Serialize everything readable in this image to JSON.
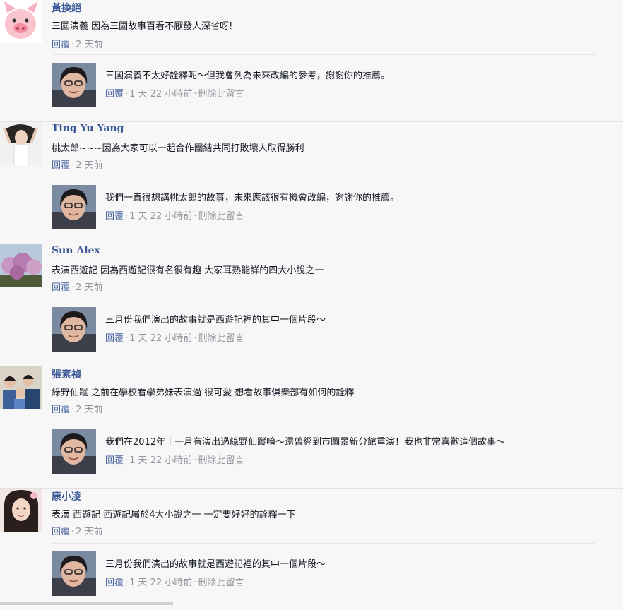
{
  "threads": [
    {
      "author": "黃換絕",
      "text": "三國演義 因為三國故事百看不厭發人深省呀!",
      "reply_label": "回覆",
      "time": "2 天前",
      "reply": {
        "text": "三國演義不太好詮釋呢～但我會列為未來改編的參考，謝謝你的推薦。",
        "reply_label": "回覆",
        "time": "1 天 22 小時前",
        "delete_label": "刪除此留言"
      }
    },
    {
      "author": "Ting Yu Yang",
      "text": "桃太郎~~~因為大家可以一起合作團結共同打敗壞人取得勝利",
      "reply_label": "回覆",
      "time": "2 天前",
      "reply": {
        "text": "我們一直很想講桃太郎的故事，未來應該很有機會改編，謝謝你的推薦。",
        "reply_label": "回覆",
        "time": "1 天 22 小時前",
        "delete_label": "刪除此留言"
      }
    },
    {
      "author": "Sun Alex",
      "text": "表演西遊記 因為西遊記很有名很有趣 大家耳熟能詳的四大小說之一",
      "reply_label": "回覆",
      "time": "2 天前",
      "reply": {
        "text": "三月份我們演出的故事就是西遊記裡的其中一個片段～",
        "reply_label": "回覆",
        "time": "1 天 22 小時前",
        "delete_label": "刪除此留言"
      }
    },
    {
      "author": "張素禎",
      "text": "綠野仙蹤 之前在學校看學弟妹表演過 很可愛 想看故事俱樂部有如何的詮釋",
      "reply_label": "回覆",
      "time": "2 天前",
      "reply": {
        "text": "我們在2012年十一月有演出過綠野仙蹤唷～還曾經到市圖景新分館重演！我也非常喜歡這個故事～",
        "reply_label": "回覆",
        "time": "1 天 22 小時前",
        "delete_label": "刪除此留言"
      }
    },
    {
      "author": "康小凌",
      "text": "表演 西遊記 西遊記屬於4大小說之一 一定要好好的詮釋一下",
      "reply_label": "回覆",
      "time": "2 天前",
      "reply": {
        "text": "三月份我們演出的故事就是西遊記裡的其中一個片段～",
        "reply_label": "回覆",
        "time": "1 天 22 小時前",
        "delete_label": "刪除此留言"
      }
    }
  ],
  "colors": {
    "author_link": "#3b5998",
    "action_link": "#4b67a1",
    "meta_text": "#90949c",
    "background": "#f7f7f7"
  }
}
